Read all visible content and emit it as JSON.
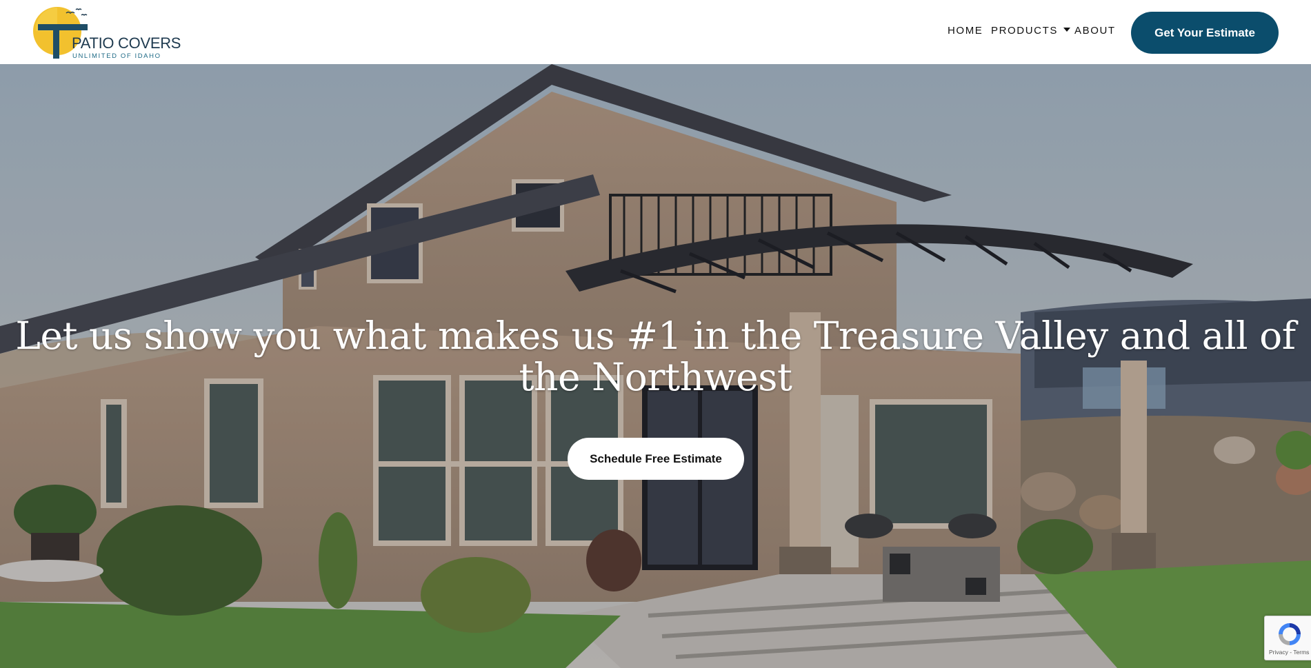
{
  "brand": {
    "title": "PATIO COVERS",
    "subtitle": "UNLIMITED OF IDAHO"
  },
  "nav": {
    "items": [
      {
        "label": "HOME"
      },
      {
        "label": "PRODUCTS",
        "has_dropdown": true
      },
      {
        "label": "ABOUT"
      }
    ],
    "cta_label": "Get Your Estimate"
  },
  "hero": {
    "heading": "Let us show you what makes us #1 in the Treasure Valley and all of the Northwest",
    "button_label": "Schedule Free Estimate"
  },
  "recaptcha": {
    "text": "Privacy - Terms"
  },
  "colors": {
    "brand_blue": "#0b4d6c",
    "logo_sun": "#f2c12e",
    "logo_teal": "#1e6a86",
    "nav_text": "#111111",
    "hero_text": "#ffffff"
  },
  "icons": [
    "logo-mark-icon",
    "caret-down-icon",
    "recaptcha-icon"
  ]
}
